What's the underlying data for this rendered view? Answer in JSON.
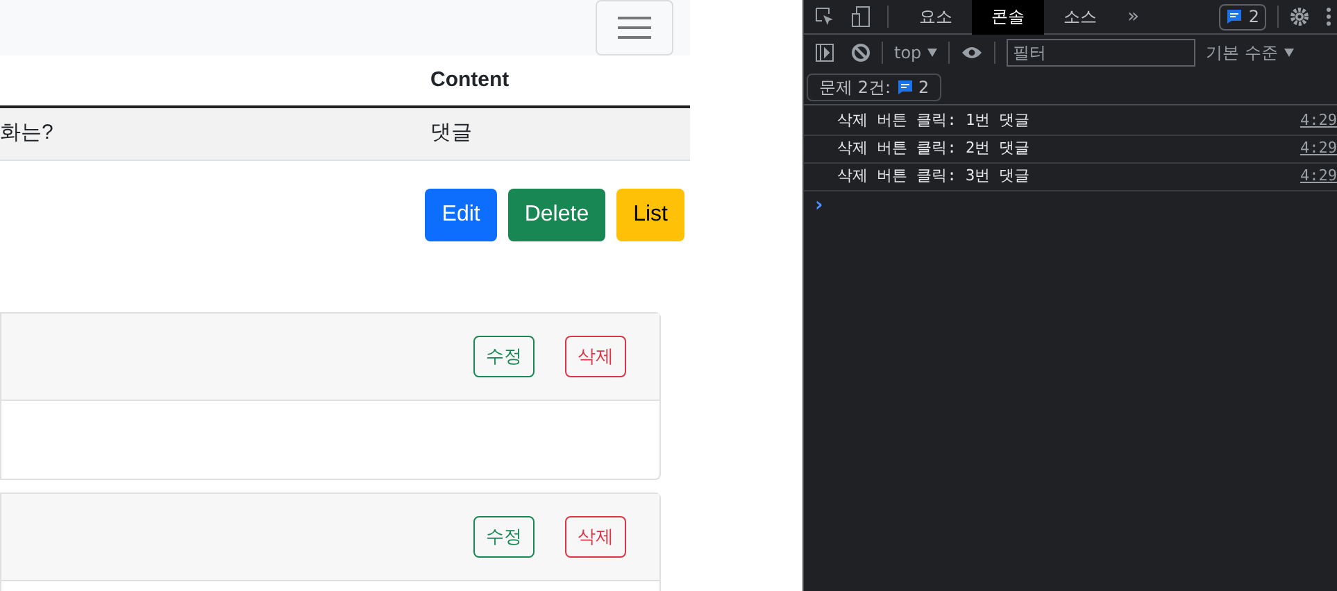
{
  "table": {
    "content_heading": "Content",
    "rows": [
      {
        "title": "화는?",
        "content": "댓글"
      }
    ]
  },
  "actions": [
    {
      "label": "Edit",
      "kind": "primary"
    },
    {
      "label": "Delete",
      "kind": "success"
    },
    {
      "label": "List",
      "kind": "warning"
    }
  ],
  "comments": [
    {
      "edit": "수정",
      "delete": "삭제"
    },
    {
      "edit": "수정",
      "delete": "삭제"
    }
  ],
  "devtools": {
    "tabs": [
      {
        "label": "요소",
        "selected": false
      },
      {
        "label": "콘솔",
        "selected": true
      },
      {
        "label": "소스",
        "selected": false
      }
    ],
    "more": "»",
    "issues_badge": "2",
    "context": "top",
    "filter_placeholder": "필터",
    "level": "기본 수준",
    "issues_label": "문제 2건:",
    "issues_count": "2",
    "logs": [
      {
        "message": "삭제 버튼 클릭: 1번 댓글",
        "time": "4:29"
      },
      {
        "message": "삭제 버튼 클릭: 2번 댓글",
        "time": "4:29"
      },
      {
        "message": "삭제 버튼 클릭: 3번 댓글",
        "time": "4:29"
      }
    ],
    "prompt": "›"
  }
}
